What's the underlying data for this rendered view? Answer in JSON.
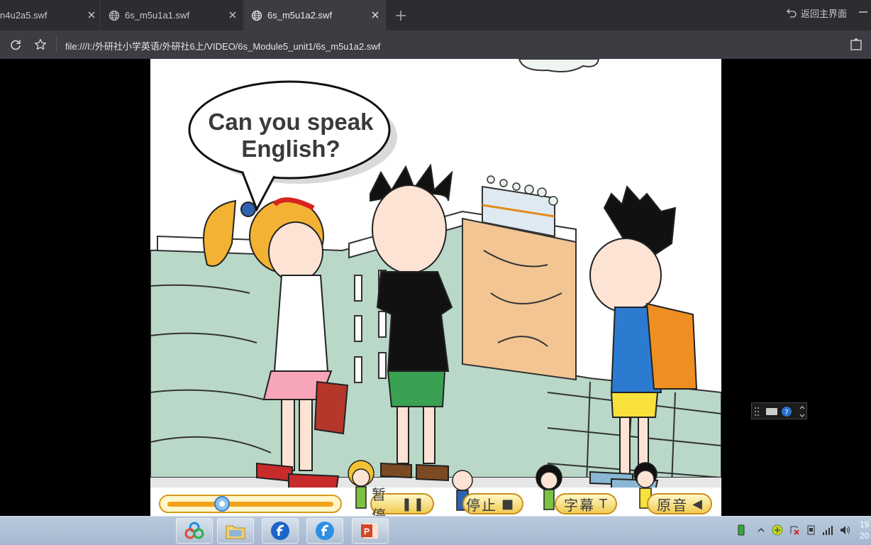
{
  "tabs": [
    {
      "label": "n4u2a5.swf",
      "active": false
    },
    {
      "label": "6s_m5u1a1.swf",
      "active": false
    },
    {
      "label": "6s_m5u1a2.swf",
      "active": true
    }
  ],
  "toolbar": {
    "home_label": "返回主界面",
    "address": "file:///I:/外研社小学英语/外研社6上/VIDEO/6s_Module5_unit1/6s_m5u1a2.swf"
  },
  "scene": {
    "speech": "Can you speak English?"
  },
  "controls": {
    "progress": 0.33,
    "pause_label": "暂停",
    "stop_label": "停止",
    "subtitle_label": "字幕",
    "audio_label": "原音"
  },
  "clock": {
    "time": "19",
    "date": "20"
  },
  "colors": {
    "tabbar": "#2b2d31",
    "addrbar": "#3b3d42",
    "taskbar": "#b0c2d7",
    "control_gold": "#f1cb52"
  }
}
